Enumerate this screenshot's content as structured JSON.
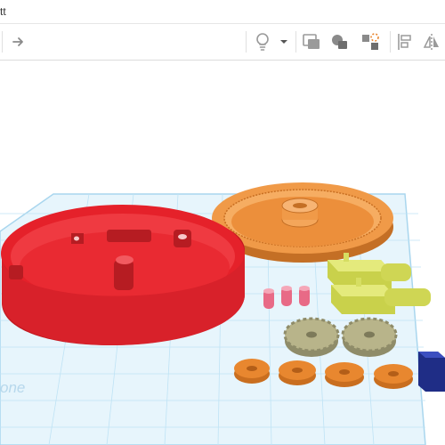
{
  "window": {
    "title_fragment": "tt"
  },
  "toolbar": {
    "buttons": [
      {
        "name": "redo",
        "icon": "redo-arrow-icon"
      },
      {
        "name": "light",
        "icon": "lightbulb-icon"
      },
      {
        "name": "light-dropdown",
        "icon": "caret-down-icon"
      },
      {
        "name": "view-group",
        "icon": "group-view-icon"
      },
      {
        "name": "shape",
        "icon": "shape-icon"
      },
      {
        "name": "transform",
        "icon": "transform-icon"
      },
      {
        "name": "align",
        "icon": "align-icon"
      },
      {
        "name": "mirror",
        "icon": "mirror-icon"
      }
    ]
  },
  "workplane": {
    "watermark": "one",
    "grid_color": "#bfe3f5",
    "objects": [
      {
        "name": "red-base",
        "color": "#e5212a"
      },
      {
        "name": "ring-gear",
        "color": "#f09a48"
      },
      {
        "name": "motor-1",
        "color": "#d7e05a"
      },
      {
        "name": "motor-2",
        "color": "#d7e05a"
      },
      {
        "name": "pink-pin-1",
        "color": "#e86a86"
      },
      {
        "name": "pink-pin-2",
        "color": "#e86a86"
      },
      {
        "name": "pink-pin-3",
        "color": "#e86a86"
      },
      {
        "name": "spur-gear-1",
        "color": "#b8b48a"
      },
      {
        "name": "spur-gear-2",
        "color": "#b8b48a"
      },
      {
        "name": "washer-1",
        "color": "#e8872f"
      },
      {
        "name": "washer-2",
        "color": "#e8872f"
      },
      {
        "name": "washer-3",
        "color": "#e8872f"
      },
      {
        "name": "washer-4",
        "color": "#e8872f"
      },
      {
        "name": "blue-bracket",
        "color": "#2d3fa6"
      }
    ]
  }
}
